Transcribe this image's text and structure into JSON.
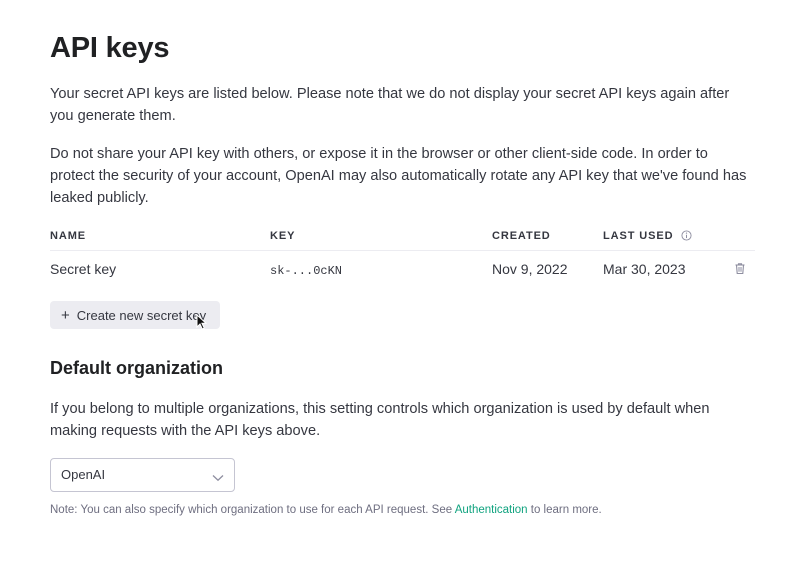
{
  "page": {
    "title": "API keys",
    "intro_1": "Your secret API keys are listed below. Please note that we do not display your secret API keys again after you generate them.",
    "intro_2": "Do not share your API key with others, or expose it in the browser or other client-side code. In order to protect the security of your account, OpenAI may also automatically rotate any API key that we've found has leaked publicly."
  },
  "table": {
    "headers": {
      "name": "NAME",
      "key": "KEY",
      "created": "CREATED",
      "last_used": "LAST USED"
    },
    "rows": [
      {
        "name": "Secret key",
        "key": "sk-...0cKN",
        "created": "Nov 9, 2022",
        "last_used": "Mar 30, 2023"
      }
    ]
  },
  "actions": {
    "create_plus": "+",
    "create_label": "Create new secret key"
  },
  "org": {
    "title": "Default organization",
    "description": "If you belong to multiple organizations, this setting controls which organization is used by default when making requests with the API keys above.",
    "selected": "OpenAI",
    "note_before": "Note: You can also specify which organization to use for each API request. See ",
    "note_link": "Authentication",
    "note_after": " to learn more."
  },
  "colors": {
    "text": "#353740",
    "heading": "#202123",
    "link": "#10a37f",
    "button_bg": "#ececf1",
    "muted": "#6e6e80"
  },
  "icons": {
    "info": "info-icon",
    "trash": "trash-icon",
    "chevron": "chevron-down-icon",
    "cursor": "pointer-cursor-icon"
  }
}
